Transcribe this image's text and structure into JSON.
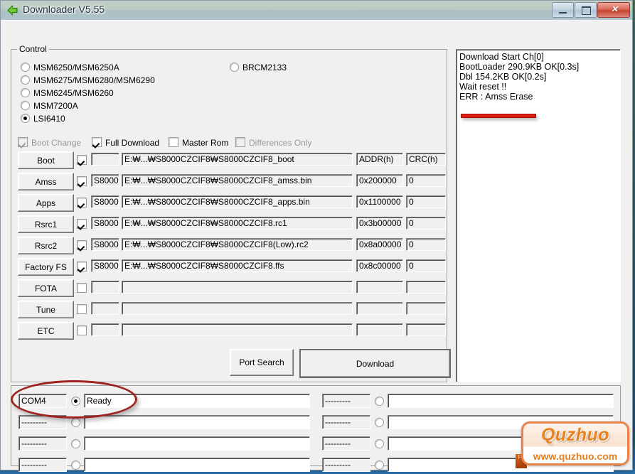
{
  "window": {
    "title": "Downloader V5.55",
    "icon": "back-arrow-icon",
    "minimize": "–",
    "maximize": "□",
    "close": "✕"
  },
  "control": {
    "legend": "Control",
    "chipsets": [
      {
        "label": "MSM6250/MSM6250A",
        "selected": false
      },
      {
        "label": "MSM6275/MSM6280/MSM6290",
        "selected": false
      },
      {
        "label": "MSM6245/MSM6260",
        "selected": false
      },
      {
        "label": "MSM7200A",
        "selected": false
      },
      {
        "label": "LSI6410",
        "selected": true
      }
    ],
    "chipsets_right": [
      {
        "label": "BRCM2133",
        "selected": false
      }
    ],
    "options": [
      {
        "label": "Boot Change",
        "checked": true,
        "disabled": true
      },
      {
        "label": "Full Download",
        "checked": true,
        "disabled": false
      },
      {
        "label": "Master Rom",
        "checked": false,
        "disabled": false
      },
      {
        "label": "Differences Only",
        "checked": false,
        "disabled": true
      }
    ],
    "headers": {
      "addr": "ADDR(h)",
      "crc": "CRC(h)"
    },
    "rows": [
      {
        "button": "Boot",
        "checked": true,
        "tag": "",
        "path": "E:₩...₩S8000CZCIF8₩S8000CZCIF8_boot",
        "addr": "",
        "crc": "",
        "header_row": true
      },
      {
        "button": "Amss",
        "checked": true,
        "tag": "S8000",
        "path": "E:₩...₩S8000CZCIF8₩S8000CZCIF8_amss.bin",
        "addr": "0x200000",
        "crc": "0"
      },
      {
        "button": "Apps",
        "checked": true,
        "tag": "S8000",
        "path": "E:₩...₩S8000CZCIF8₩S8000CZCIF8_apps.bin",
        "addr": "0x1100000",
        "crc": "0"
      },
      {
        "button": "Rsrc1",
        "checked": true,
        "tag": "S8000",
        "path": "E:₩...₩S8000CZCIF8₩S8000CZCIF8.rc1",
        "addr": "0x3b00000",
        "crc": "0"
      },
      {
        "button": "Rsrc2",
        "checked": true,
        "tag": "S8000",
        "path": "E:₩...₩S8000CZCIF8₩S8000CZCIF8(Low).rc2",
        "addr": "0x8a00000",
        "crc": "0"
      },
      {
        "button": "Factory FS",
        "checked": true,
        "tag": "S8000",
        "path": "E:₩...₩S8000CZCIF8₩S8000CZCIF8.ffs",
        "addr": "0x8c00000",
        "crc": "0"
      },
      {
        "button": "FOTA",
        "checked": false,
        "tag": "",
        "path": "",
        "addr": "",
        "crc": ""
      },
      {
        "button": "Tune",
        "checked": false,
        "tag": "",
        "path": "",
        "addr": "",
        "crc": ""
      },
      {
        "button": "ETC",
        "checked": false,
        "tag": "",
        "path": "",
        "addr": "",
        "crc": ""
      }
    ],
    "port_search_label": "Port Search",
    "download_label": "Download"
  },
  "log": {
    "lines": [
      "Download Start Ch[0]",
      "BootLoader 290.9KB OK[0.3s]",
      "Dbl 154.2KB OK[0.2s]",
      "Wait reset !!",
      "ERR : Amss Erase"
    ]
  },
  "ports": {
    "left": [
      {
        "name": "COM4",
        "selected": true,
        "status": "Ready"
      },
      {
        "name": "---------",
        "selected": false,
        "status": ""
      },
      {
        "name": "---------",
        "selected": false,
        "status": ""
      },
      {
        "name": "---------",
        "selected": false,
        "status": ""
      }
    ],
    "right": [
      {
        "name": "---------",
        "selected": false,
        "status": ""
      },
      {
        "name": "---------",
        "selected": false,
        "status": ""
      },
      {
        "name": "---------",
        "selected": false,
        "status": ""
      },
      {
        "name": "---------",
        "selected": false,
        "status": ""
      }
    ]
  },
  "watermark": {
    "logo": "Quzhuo",
    "url": "www.quzhuo.com",
    "badge": "FL"
  },
  "colors": {
    "annotation_red": "#9e2420",
    "underline_red": "#e01b12",
    "watermark_orange": "#e8811f",
    "window_face": "#f0f0f0"
  }
}
